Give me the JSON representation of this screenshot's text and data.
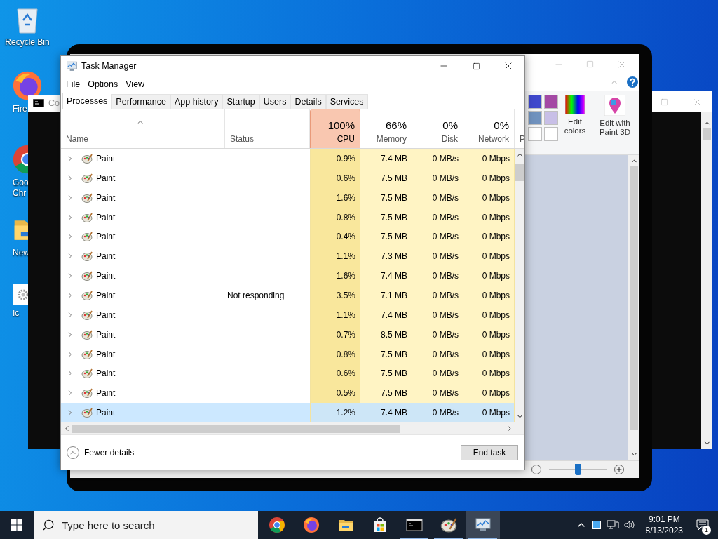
{
  "desktop_icons": [
    {
      "kind": "recycle",
      "lines": [
        "Recycle Bin"
      ]
    },
    {
      "kind": "firefox",
      "lines": [
        "Fire"
      ]
    },
    {
      "kind": "chrome",
      "lines": [
        "Goo",
        "Chr"
      ]
    },
    {
      "kind": "folder",
      "lines": [
        "New"
      ]
    },
    {
      "kind": "settings",
      "lines": [
        "Ic"
      ]
    }
  ],
  "console_window": {
    "title": "Co"
  },
  "paint_window": {
    "swatches": [
      {
        "color": "#3f48cc"
      },
      {
        "color": "#a349a4"
      },
      {
        "color": "#7092be"
      },
      {
        "color": "#c8bfe7"
      },
      {
        "color": "#ffffff"
      },
      {
        "color": "#ffffff"
      }
    ],
    "buttons": [
      {
        "kind": "edit-colors",
        "label": "Edit colors"
      },
      {
        "kind": "paint3d",
        "label": "Edit with Paint 3D"
      }
    ],
    "zoom": {
      "level": 0.5
    }
  },
  "task_manager": {
    "title": "Task Manager",
    "menu": [
      "File",
      "Options",
      "View"
    ],
    "tabs": [
      {
        "label": "Processes",
        "selected": true
      },
      {
        "label": "Performance",
        "selected": false
      },
      {
        "label": "App history",
        "selected": false
      },
      {
        "label": "Startup",
        "selected": false
      },
      {
        "label": "Users",
        "selected": false
      },
      {
        "label": "Details",
        "selected": false
      },
      {
        "label": "Services",
        "selected": false
      }
    ],
    "columns": [
      {
        "label": "Name",
        "kind": "name"
      },
      {
        "label": "Status",
        "kind": "status"
      },
      {
        "label": "CPU",
        "total": "100%",
        "kind": "metric",
        "alert": true
      },
      {
        "label": "Memory",
        "total": "66%",
        "kind": "metric",
        "alert": false
      },
      {
        "label": "Disk",
        "total": "0%",
        "kind": "metric",
        "alert": false
      },
      {
        "label": "Network",
        "total": "0%",
        "kind": "metric",
        "alert": false
      },
      {
        "label": "P",
        "kind": "cut"
      }
    ],
    "rows": [
      {
        "name": "Paint",
        "status": "",
        "cpu": "0.9%",
        "memory": "7.4 MB",
        "disk": "0 MB/s",
        "network": "0 Mbps",
        "selected": false
      },
      {
        "name": "Paint",
        "status": "",
        "cpu": "0.6%",
        "memory": "7.5 MB",
        "disk": "0 MB/s",
        "network": "0 Mbps",
        "selected": false
      },
      {
        "name": "Paint",
        "status": "",
        "cpu": "1.6%",
        "memory": "7.5 MB",
        "disk": "0 MB/s",
        "network": "0 Mbps",
        "selected": false
      },
      {
        "name": "Paint",
        "status": "",
        "cpu": "0.8%",
        "memory": "7.5 MB",
        "disk": "0 MB/s",
        "network": "0 Mbps",
        "selected": false
      },
      {
        "name": "Paint",
        "status": "",
        "cpu": "0.4%",
        "memory": "7.5 MB",
        "disk": "0 MB/s",
        "network": "0 Mbps",
        "selected": false
      },
      {
        "name": "Paint",
        "status": "",
        "cpu": "1.1%",
        "memory": "7.3 MB",
        "disk": "0 MB/s",
        "network": "0 Mbps",
        "selected": false
      },
      {
        "name": "Paint",
        "status": "",
        "cpu": "1.6%",
        "memory": "7.4 MB",
        "disk": "0 MB/s",
        "network": "0 Mbps",
        "selected": false
      },
      {
        "name": "Paint",
        "status": "Not responding",
        "cpu": "3.5%",
        "memory": "7.1 MB",
        "disk": "0 MB/s",
        "network": "0 Mbps",
        "selected": false
      },
      {
        "name": "Paint",
        "status": "",
        "cpu": "1.1%",
        "memory": "7.4 MB",
        "disk": "0 MB/s",
        "network": "0 Mbps",
        "selected": false
      },
      {
        "name": "Paint",
        "status": "",
        "cpu": "0.7%",
        "memory": "8.5 MB",
        "disk": "0 MB/s",
        "network": "0 Mbps",
        "selected": false
      },
      {
        "name": "Paint",
        "status": "",
        "cpu": "0.8%",
        "memory": "7.5 MB",
        "disk": "0 MB/s",
        "network": "0 Mbps",
        "selected": false
      },
      {
        "name": "Paint",
        "status": "",
        "cpu": "0.6%",
        "memory": "7.5 MB",
        "disk": "0 MB/s",
        "network": "0 Mbps",
        "selected": false
      },
      {
        "name": "Paint",
        "status": "",
        "cpu": "0.5%",
        "memory": "7.5 MB",
        "disk": "0 MB/s",
        "network": "0 Mbps",
        "selected": false
      },
      {
        "name": "Paint",
        "status": "",
        "cpu": "1.2%",
        "memory": "7.4 MB",
        "disk": "0 MB/s",
        "network": "0 Mbps",
        "selected": true
      }
    ],
    "footer": {
      "toggle": "Fewer details",
      "button": "End task"
    }
  },
  "taskbar": {
    "search": {
      "placeholder": "Type here to search"
    },
    "apps": [
      {
        "kind": "chrome",
        "running": false,
        "selected": false
      },
      {
        "kind": "firefox",
        "running": false,
        "selected": false
      },
      {
        "kind": "explorer",
        "running": false,
        "selected": false
      },
      {
        "kind": "store",
        "running": false,
        "selected": false
      },
      {
        "kind": "terminal",
        "running": true,
        "selected": false
      },
      {
        "kind": "paint",
        "running": true,
        "selected": false
      },
      {
        "kind": "taskmgr",
        "running": true,
        "selected": true
      }
    ],
    "tray": {
      "time": "9:01 PM",
      "date": "8/13/2023",
      "notifications": "1"
    }
  }
}
